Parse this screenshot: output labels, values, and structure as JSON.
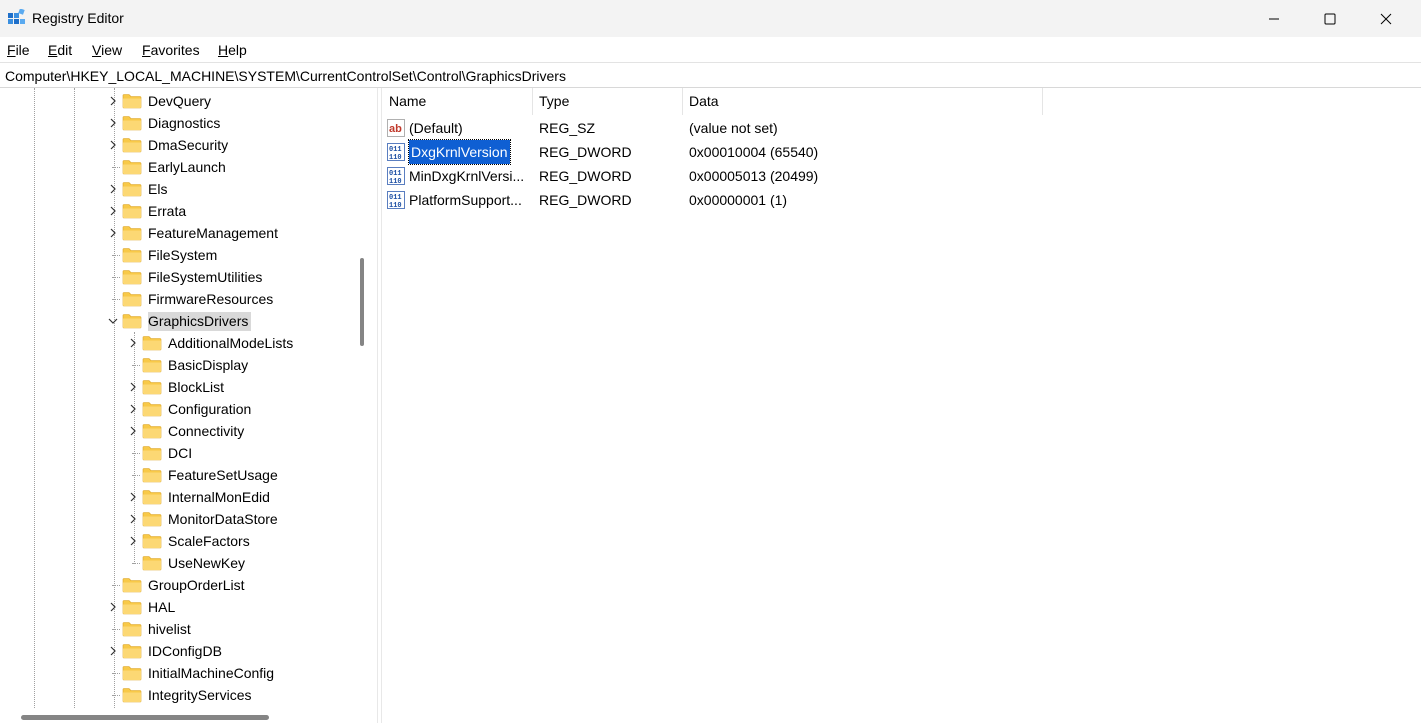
{
  "window": {
    "title": "Registry Editor",
    "icon": "registry-icon",
    "controls": [
      "minimize-icon",
      "maximize-icon",
      "close-icon"
    ]
  },
  "menu": {
    "file": "File",
    "edit": "Edit",
    "view": "View",
    "favorites": "Favorites",
    "help": "Help"
  },
  "address": "Computer\\HKEY_LOCAL_MACHINE\\SYSTEM\\CurrentControlSet\\Control\\GraphicsDrivers",
  "tree": {
    "parent_items": [
      {
        "label": "DevQuery",
        "expandable": true
      },
      {
        "label": "Diagnostics",
        "expandable": true
      },
      {
        "label": "DmaSecurity",
        "expandable": true
      },
      {
        "label": "EarlyLaunch",
        "expandable": false
      },
      {
        "label": "Els",
        "expandable": true
      },
      {
        "label": "Errata",
        "expandable": true
      },
      {
        "label": "FeatureManagement",
        "expandable": true
      },
      {
        "label": "FileSystem",
        "expandable": false
      },
      {
        "label": "FileSystemUtilities",
        "expandable": false
      },
      {
        "label": "FirmwareResources",
        "expandable": false
      },
      {
        "label": "GraphicsDrivers",
        "expandable": true,
        "expanded": true,
        "selected": true
      }
    ],
    "child_items": [
      {
        "label": "AdditionalModeLists",
        "expandable": true
      },
      {
        "label": "BasicDisplay",
        "expandable": false
      },
      {
        "label": "BlockList",
        "expandable": true
      },
      {
        "label": "Configuration",
        "expandable": true
      },
      {
        "label": "Connectivity",
        "expandable": true
      },
      {
        "label": "DCI",
        "expandable": false
      },
      {
        "label": "FeatureSetUsage",
        "expandable": false
      },
      {
        "label": "InternalMonEdid",
        "expandable": true
      },
      {
        "label": "MonitorDataStore",
        "expandable": true
      },
      {
        "label": "ScaleFactors",
        "expandable": true
      },
      {
        "label": "UseNewKey",
        "expandable": false
      }
    ],
    "after_items": [
      {
        "label": "GroupOrderList",
        "expandable": false
      },
      {
        "label": "HAL",
        "expandable": true
      },
      {
        "label": "hivelist",
        "expandable": false
      },
      {
        "label": "IDConfigDB",
        "expandable": true
      },
      {
        "label": "InitialMachineConfig",
        "expandable": false
      },
      {
        "label": "IntegrityServices",
        "expandable": false
      }
    ]
  },
  "values": {
    "headers": {
      "name": "Name",
      "type": "Type",
      "data": "Data"
    },
    "rows": [
      {
        "icon": "string-value-icon",
        "name": "(Default)",
        "type": "REG_SZ",
        "data": "(value not set)",
        "selected": false
      },
      {
        "icon": "binary-value-icon",
        "name": "DxgKrnlVersion",
        "type": "REG_DWORD",
        "data": "0x00010004 (65540)",
        "selected": true
      },
      {
        "icon": "binary-value-icon",
        "name": "MinDxgKrnlVersi...",
        "type": "REG_DWORD",
        "data": "0x00005013 (20499)",
        "selected": false
      },
      {
        "icon": "binary-value-icon",
        "name": "PlatformSupport...",
        "type": "REG_DWORD",
        "data": "0x00000001 (1)",
        "selected": false
      }
    ]
  },
  "colors": {
    "selection": "#0f5fd3",
    "folder": "#f8c948",
    "tree_selection": "#d9d9d9"
  }
}
